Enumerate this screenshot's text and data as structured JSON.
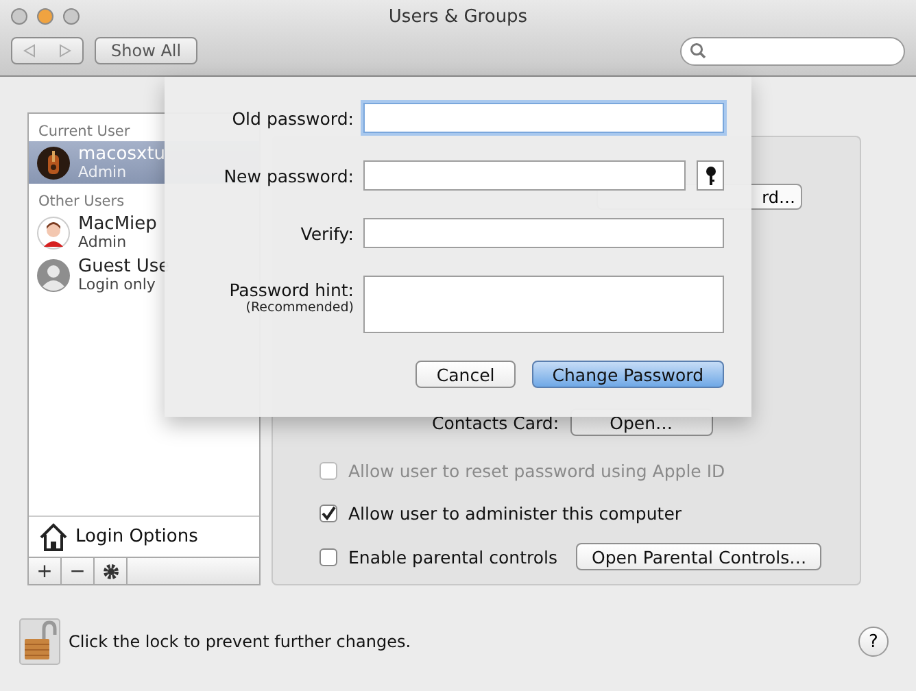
{
  "window": {
    "title": "Users & Groups"
  },
  "toolbar": {
    "show_all": "Show All"
  },
  "user_list": {
    "sections": [
      {
        "heading": "Current User",
        "users": [
          {
            "name": "macosxtu",
            "role": "Admin",
            "selected": true
          }
        ]
      },
      {
        "heading": "Other Users",
        "users": [
          {
            "name": "MacMiep",
            "role": "Admin",
            "kind": "cartoon",
            "selected": false
          },
          {
            "name": "Guest Use",
            "role": "Login only",
            "kind": "silhouette",
            "selected": false
          }
        ]
      }
    ],
    "login_options": "Login Options",
    "buttons": [
      "+",
      "−"
    ]
  },
  "panel": {
    "change_password_fragment": "rd…",
    "contacts_label": "Contacts Card:",
    "contacts_button": "Open…",
    "checkboxes": [
      {
        "label": "Allow user to reset password using Apple ID",
        "checked": false,
        "disabled": true
      },
      {
        "label": "Allow user to administer this computer",
        "checked": true,
        "disabled": false
      },
      {
        "label": "Enable parental controls",
        "checked": false,
        "disabled": false,
        "button": "Open Parental Controls…"
      }
    ]
  },
  "sheet": {
    "fields": [
      {
        "label": "Old password:",
        "kind": "password",
        "focused": true
      },
      {
        "label": "New password:",
        "kind": "password_key",
        "focused": false
      },
      {
        "label": "Verify:",
        "kind": "password",
        "focused": false
      },
      {
        "label": "Password hint:",
        "note": "(Recommended)",
        "kind": "hint",
        "focused": false
      }
    ],
    "cancel": "Cancel",
    "confirm": "Change Password"
  },
  "footer": {
    "lock_text": "Click the lock to prevent further changes.",
    "help": "?"
  }
}
